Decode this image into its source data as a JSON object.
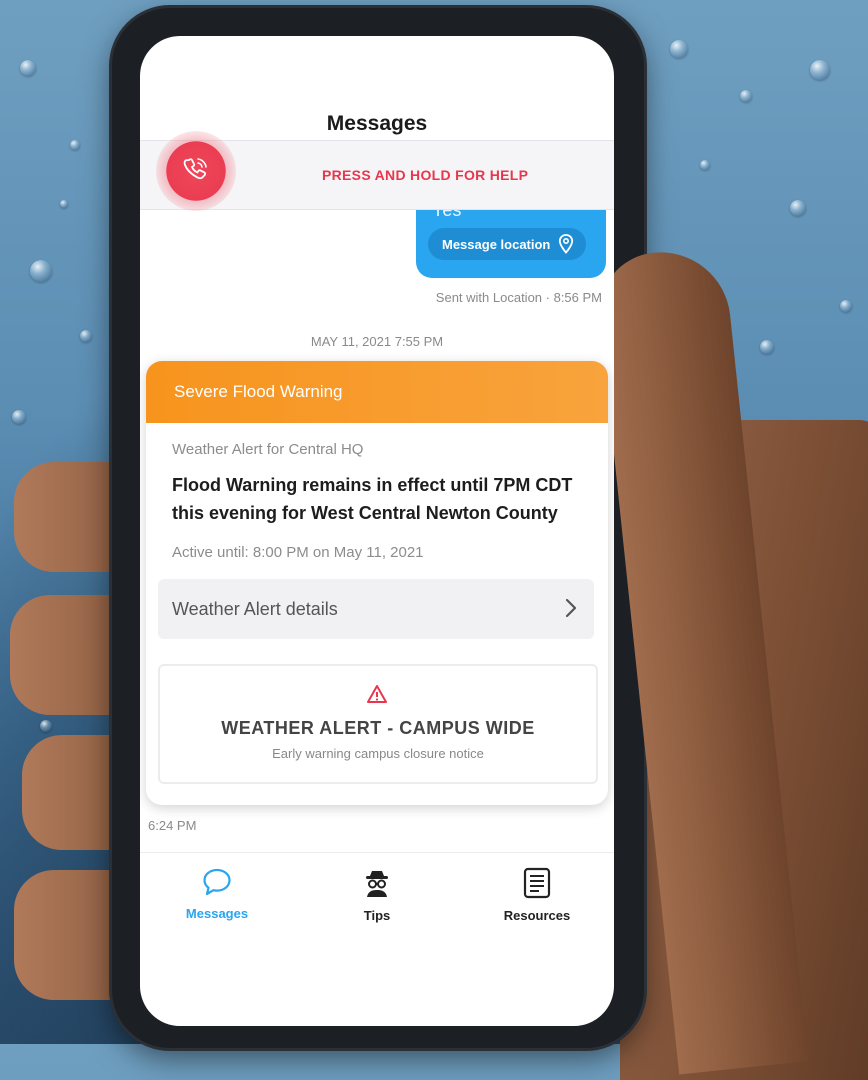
{
  "header": {
    "title": "Messages"
  },
  "help": {
    "label": "PRESS AND HOLD FOR HELP",
    "icon": "phone-call-icon",
    "color": "#e8374d"
  },
  "sent_message": {
    "text": "Yes",
    "location_button": "Message location",
    "location_icon": "location-pin-icon",
    "status": "Sent with Location · 8:56 PM",
    "color": "#2aa5f0"
  },
  "date_divider": "MAY 11, 2021 7:55 PM",
  "alert_card": {
    "header": "Severe Flood Warning",
    "header_color": "#f7941d",
    "subtitle": "Weather Alert for Central HQ",
    "body": "Flood Warning remains in effect until 7PM CDT this evening for West Central Newton County",
    "active_until": "Active until:  8:00 PM on May 11, 2021",
    "details_label": "Weather Alert details",
    "details_icon": "chevron-right-icon",
    "notice_icon": "warning-triangle-icon",
    "notice_title": "WEATHER ALERT - CAMPUS WIDE",
    "notice_subtitle": "Early warning campus closure notice"
  },
  "message_time": "6:24 PM",
  "bottom_nav": {
    "items": [
      {
        "label": "Messages",
        "icon": "chat-bubble-icon",
        "active": true
      },
      {
        "label": "Tips",
        "icon": "spy-icon",
        "active": false
      },
      {
        "label": "Resources",
        "icon": "document-list-icon",
        "active": false
      }
    ]
  }
}
